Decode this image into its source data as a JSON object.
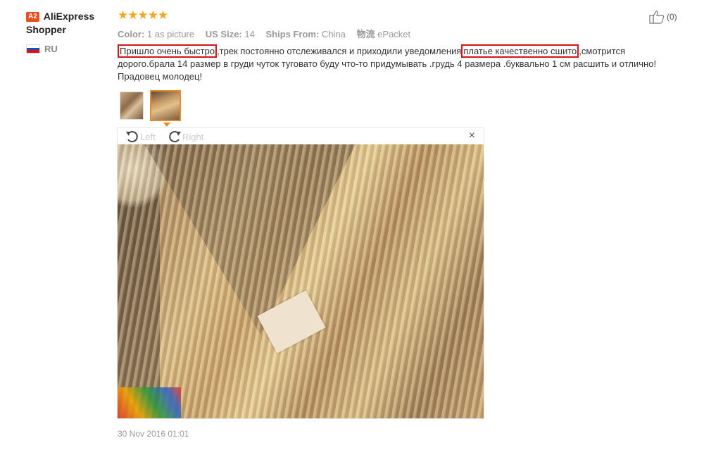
{
  "user": {
    "badge": "A2",
    "name": "AliExpress Shopper",
    "country_code": "RU",
    "flag_colors": [
      "#ffffff",
      "#1f4fb5",
      "#d8141b"
    ]
  },
  "rating": {
    "stars": 5,
    "glyphs": "★★★★★"
  },
  "meta": {
    "color_key": "Color:",
    "color_val": "1 as picture",
    "size_key": "US Size:",
    "size_val": "14",
    "ships_key": "Ships From:",
    "ships_val": "China",
    "logistics_key": "物流",
    "logistics_val": "ePacket"
  },
  "like": {
    "count": "(0)",
    "icon": "thumbs-up-icon"
  },
  "review": {
    "p1_highlight": "Пришло очень быстро",
    "p2": ",трек постоянно отслеживался и приходили уведомления",
    "p3_highlight": "платье качественно сшито",
    "p4": ",смотрится дорого.брала 14 размер в груди чуток туговато буду что-то придумывать .грудь 4 размера .буквально 1 см расшить и отлично!Прадовец молодец!",
    "highlight_color": "#d8141b"
  },
  "viewer": {
    "rotate_left": "Left",
    "rotate_right": "Right",
    "close": "×",
    "selected_thumb": 2
  },
  "date": "30 Nov 2016 01:01",
  "colors": {
    "accent_orange": "#e88b25",
    "star": "#f5a623",
    "badge": "#e94f1d"
  }
}
